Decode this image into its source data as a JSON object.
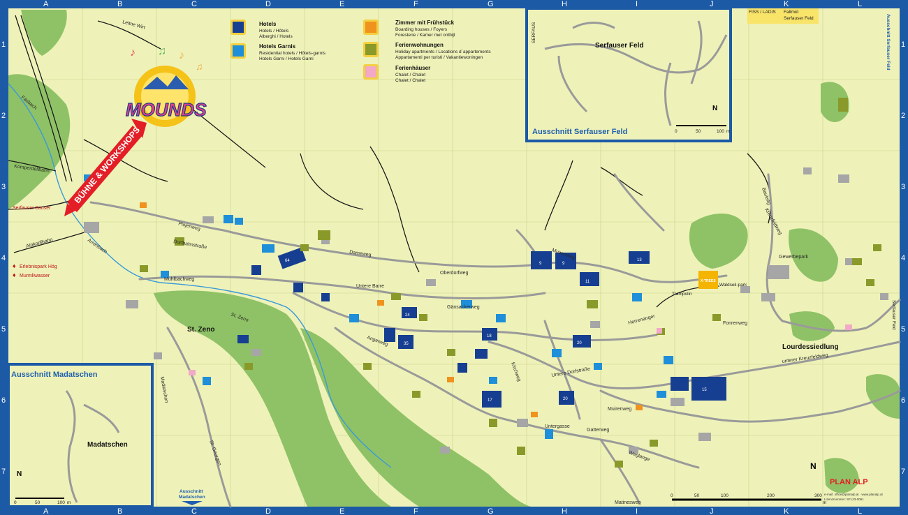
{
  "frame": {
    "columns": [
      "A",
      "B",
      "C",
      "D",
      "E",
      "F",
      "G",
      "H",
      "I",
      "J",
      "K",
      "L"
    ],
    "rows": [
      "1",
      "2",
      "3",
      "4",
      "5",
      "6",
      "7"
    ]
  },
  "logo": {
    "text": "MOUNDS"
  },
  "banner": {
    "text": "BÜHNE & WORKSHOPS"
  },
  "legend": [
    {
      "title": "Hotels",
      "lines": [
        "Hotels / Hôtels",
        "Alberghi / Hotels"
      ],
      "color": "#173f91"
    },
    {
      "title": "Hotels Garnis",
      "lines": [
        "Residential hotels / Hôtels-garnis",
        "Hotels Garni / Hotels Garni"
      ],
      "color": "#1e8fd8"
    },
    {
      "title": "Zimmer mit Frühstück",
      "lines": [
        "Boarding houses / Foyers",
        "Foresterie / Kamer met ontbijt"
      ],
      "color": "#f0921e"
    },
    {
      "title": "Ferienwohnungen",
      "lines": [
        "Holiday apartments / Locations d´appartements",
        "Appartamenti per turisti / Vakantiewoningen"
      ],
      "color": "#8a9a2a"
    },
    {
      "title": "Ferienhäuser",
      "lines": [
        "Chalet / Chalet",
        "Chalet / Chalet"
      ],
      "color": "#f2a9c8"
    }
  ],
  "inset_serfaus": {
    "title": "Ausschnitt Serfauser Feld",
    "place": "Serfauser Feld",
    "side_label": "SERFAUS",
    "scale": [
      "0",
      "50",
      "100"
    ],
    "scale_unit": "m"
  },
  "inset_madatschen": {
    "title": "Ausschnitt Madatschen",
    "place": "Madatschen",
    "scale": [
      "0",
      "50",
      "100"
    ],
    "scale_unit": "m"
  },
  "main_scale": {
    "ticks": [
      "0",
      "50",
      "100",
      "200",
      "300"
    ],
    "unit": "m"
  },
  "north": "N",
  "places": [
    "St. Zeno",
    "Lourdessiedlung",
    "Waldseil-park",
    "Trampolin"
  ],
  "poi": [
    "Erlebnispark Hög",
    "Murmliwasser",
    "Serfauser Sauser"
  ],
  "signs": {
    "fiss": [
      "FISS / LADIS",
      "Fallmid",
      "Serfauser Feld"
    ],
    "serfaus_right": "Serfauser Feld",
    "serfaus_top_right": "Ausschnitt Serfauser Feld",
    "madatschen_bottom": [
      "Ausschnitt",
      "Madatschen"
    ]
  },
  "streets": [
    "Dorfbahnstraße",
    "Plojenweg",
    "Muhlbachweg",
    "Untere Dorfstraße",
    "Gänsackerweg",
    "Oberdorfweg",
    "Dameweg",
    "Untere Barre",
    "Fonrenweg",
    "Herrenanger",
    "Muirenweg",
    "Untergasse",
    "Gatterweg",
    "Weglange",
    "Untere Kreuzfeldweg",
    "Alpkopfbahn",
    "Komperdellbahn",
    "Leitne Wirt",
    "Madatschen",
    "St. Georgen",
    "Matinesweg",
    "Bauleitg",
    "Kreuzfeldweg",
    "Muirenweg",
    "Gewerbepark",
    "Fäsbach",
    "Arrenbach",
    "Angerweg",
    "Kirchweg",
    "St. Zeno"
  ],
  "footer": {
    "brand": "PLAN ALP",
    "lines": [
      "e-mail: office@planalp.at · www.planalp.at",
      "Lizenznummer: SFL23-0061"
    ]
  },
  "colors": {
    "frame": "#1c5aa6",
    "base": "#eef2b8",
    "forest": "#8fc266",
    "road": "#8a8a8a",
    "river": "#3a9ad9"
  }
}
